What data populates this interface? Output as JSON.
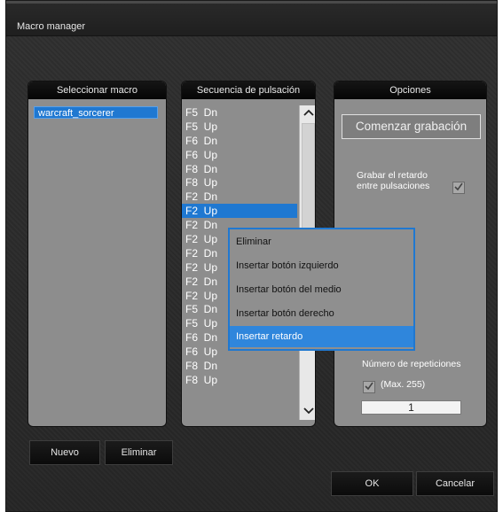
{
  "window": {
    "title": "Macro manager"
  },
  "select_panel": {
    "header": "Seleccionar macro",
    "items": [
      "warcraft_sorcerer"
    ]
  },
  "sequence_panel": {
    "header": "Secuencia de pulsación",
    "rows": [
      "F5  Dn",
      "F5  Up",
      "F6  Dn",
      "F6  Up",
      "F8  Dn",
      "F8  Up",
      "F2  Dn",
      "F2  Up",
      "F2  Dn",
      "F2  Up",
      "F2  Dn",
      "F2  Up",
      "F2  Dn",
      "F2  Up",
      "F5  Dn",
      "F5  Up",
      "F6  Dn",
      "F6  Up",
      "F8  Dn",
      "F8  Up"
    ],
    "selected_index": 7
  },
  "context_menu": {
    "items": [
      "Eliminar",
      "Insertar botón izquierdo",
      "Insertar botón del medio",
      "Insertar botón derecho",
      "Insertar retardo"
    ],
    "highlighted_index": 4
  },
  "options_panel": {
    "header": "Opciones",
    "record_button": "Comenzar grabación",
    "delay_label_line1": "Grabar el retardo",
    "delay_label_line2": "entre pulsaciones",
    "delay_checked": true,
    "repetitions_label": "Número de repeticiones",
    "repetitions_max": "(Max. 255)",
    "repetitions_checked": true,
    "repetitions_value": "1"
  },
  "bottom_buttons": {
    "new": "Nuevo",
    "delete": "Eliminar",
    "ok": "OK",
    "cancel": "Cancelar"
  },
  "icons": {
    "scroll_up": "chevron-up-icon",
    "scroll_down": "chevron-down-icon",
    "check": "checkmark-icon"
  },
  "colors": {
    "selection": "#1f78d1",
    "panel_bg": "#8d8d8d",
    "window_bg": "#2b2b2b"
  }
}
